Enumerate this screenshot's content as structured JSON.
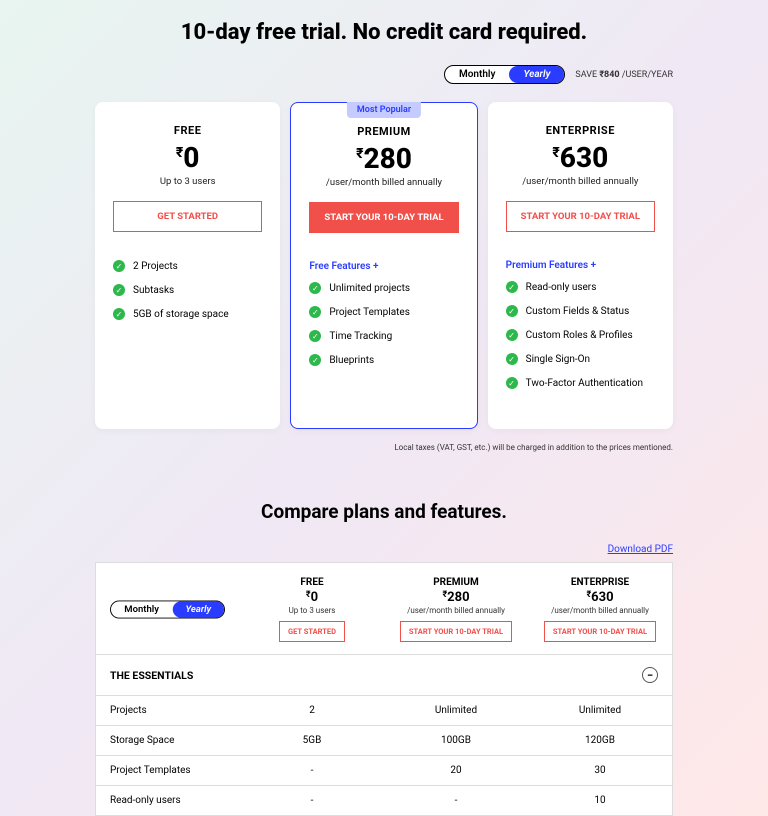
{
  "header": {
    "title": "10-day free trial. No credit card required."
  },
  "toggle": {
    "monthly": "Monthly",
    "yearly": "Yearly",
    "save": "SAVE ",
    "save_amt": "₹840",
    "save_unit": "/USER/YEAR"
  },
  "plans": {
    "free": {
      "name": "FREE",
      "currency": "₹",
      "price": "0",
      "sub": "Up to 3 users",
      "cta": "GET STARTED",
      "features": [
        "2 Projects",
        "Subtasks",
        "5GB of storage space"
      ]
    },
    "premium": {
      "badge": "Most Popular",
      "name": "PREMIUM",
      "currency": "₹",
      "price": "280",
      "sub": "/user/month billed annually",
      "cta": "START YOUR 10-DAY TRIAL",
      "feat_header": "Free Features +",
      "features": [
        "Unlimited projects",
        "Project Templates",
        "Time Tracking",
        "Blueprints"
      ]
    },
    "enterprise": {
      "name": "ENTERPRISE",
      "currency": "₹",
      "price": "630",
      "sub": "/user/month billed annually",
      "cta": "START YOUR 10-DAY TRIAL",
      "feat_header": "Premium Features +",
      "features": [
        "Read-only users",
        "Custom Fields & Status",
        "Custom Roles & Profiles",
        "Single Sign-On",
        "Two-Factor Authentication"
      ]
    }
  },
  "tax_note": "Local taxes (VAT, GST, etc.) will be charged in addition to the prices mentioned.",
  "compare": {
    "title": "Compare plans and features.",
    "download": "Download PDF",
    "section": "THE ESSENTIALS",
    "rows": [
      {
        "label": "Projects",
        "free": "2",
        "premium": "Unlimited",
        "enterprise": "Unlimited"
      },
      {
        "label": "Storage Space",
        "free": "5GB",
        "premium": "100GB",
        "enterprise": "120GB"
      },
      {
        "label": "Project Templates",
        "free": "-",
        "premium": "20",
        "enterprise": "30"
      },
      {
        "label": "Read-only users",
        "free": "-",
        "premium": "-",
        "enterprise": "10"
      }
    ]
  }
}
